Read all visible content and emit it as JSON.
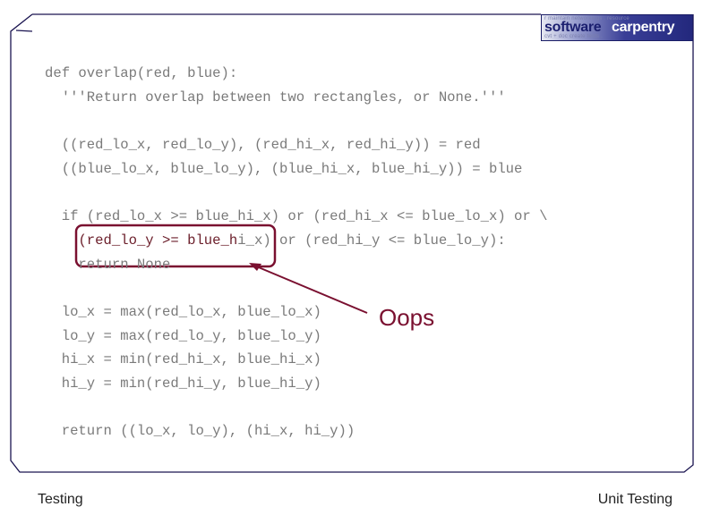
{
  "slide": {
    "logo": {
      "word1": "software",
      "word2": "carpentry",
      "faint_top": "r maintain networkings . resource ",
      "faint_bottom": "cvt + doc create tests . "
    },
    "code_lines": [
      {
        "indent": "",
        "text": "def overlap(red, blue):"
      },
      {
        "indent": "  ",
        "text": "'''Return overlap between two rectangles, or None.'''"
      },
      {
        "indent": "",
        "text": ""
      },
      {
        "indent": "  ",
        "text": "((red_lo_x, red_lo_y), (red_hi_x, red_hi_y)) = red"
      },
      {
        "indent": "  ",
        "text": "((blue_lo_x, blue_lo_y), (blue_hi_x, blue_hi_y)) = blue"
      },
      {
        "indent": "",
        "text": ""
      },
      {
        "indent": "  ",
        "text": "if (red_lo_x >= blue_hi_x) or (red_hi_x <= blue_lo_x) or \\"
      },
      {
        "indent": "    ",
        "text": "(red_lo_y >= blue_hi_x) or (red_hi_y <= blue_lo_y):",
        "highlight": "(red_lo_y >= blue_h",
        "rest": "i_x) or (red_hi_y <= blue_lo_y):"
      },
      {
        "indent": "    ",
        "text": "return None"
      },
      {
        "indent": "",
        "text": ""
      },
      {
        "indent": "  ",
        "text": "lo_x = max(red_lo_x, blue_lo_x)"
      },
      {
        "indent": "  ",
        "text": "lo_y = max(red_lo_y, blue_lo_y)"
      },
      {
        "indent": "  ",
        "text": "hi_x = min(red_hi_x, blue_hi_x)"
      },
      {
        "indent": "  ",
        "text": "hi_y = min(red_hi_y, blue_hi_y)"
      },
      {
        "indent": "",
        "text": ""
      },
      {
        "indent": "  ",
        "text": "return ((lo_x, lo_y), (hi_x, hi_y))"
      }
    ],
    "annotation": "Oops",
    "footer_left": "Testing",
    "footer_right": "Unit Testing",
    "colors": {
      "frame": "#1a1450",
      "annotation": "#7a1030",
      "code": "#7a7a7a",
      "highlight_text": "#6b1e2a"
    }
  }
}
